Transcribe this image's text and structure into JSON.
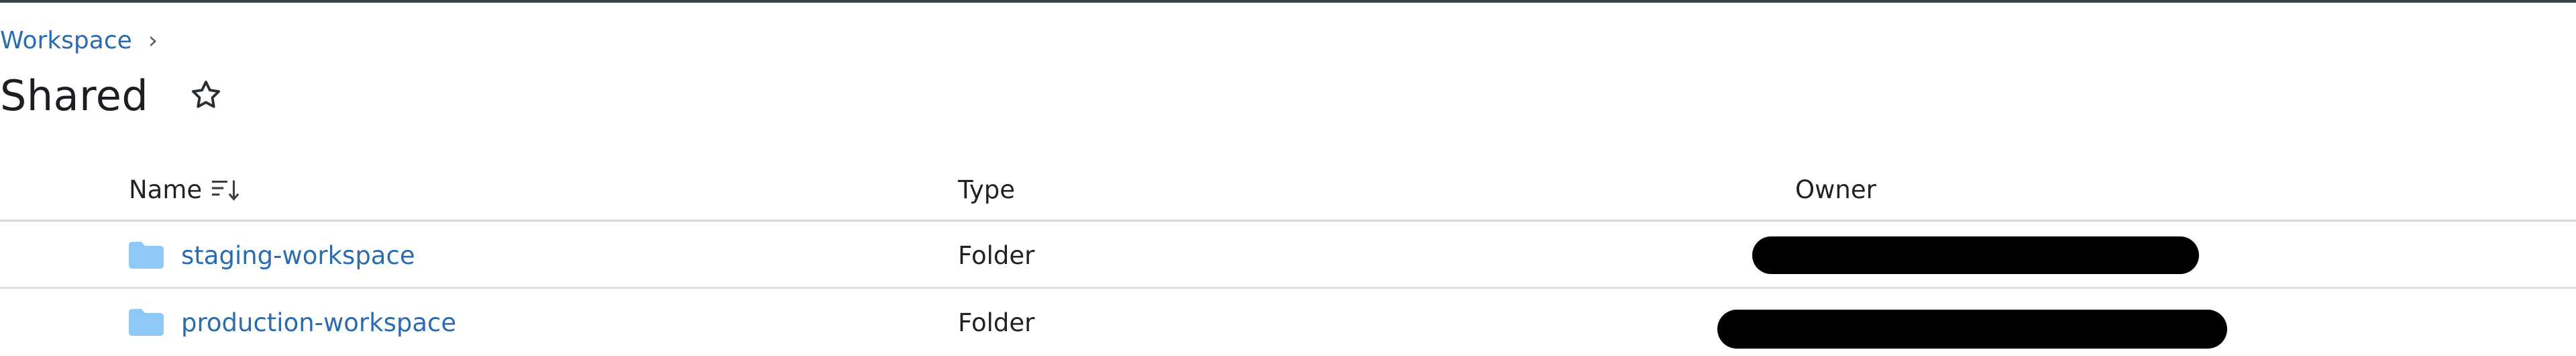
{
  "breadcrumb": {
    "items": [
      {
        "label": "Workspace"
      }
    ],
    "separator": "›"
  },
  "page": {
    "title": "Shared"
  },
  "table": {
    "columns": {
      "name": "Name",
      "type": "Type",
      "owner": "Owner"
    },
    "rows": [
      {
        "name": "staging-workspace",
        "type": "Folder",
        "owner_redacted": true
      },
      {
        "name": "production-workspace",
        "type": "Folder",
        "owner_redacted": true
      }
    ]
  },
  "colors": {
    "link": "#2b6cb0",
    "folder_icon": "#8ec9f5",
    "divider": "#d4d7db",
    "redaction": "#000000"
  },
  "icons": {
    "star": "star-outline-icon",
    "sort": "sort-descending-icon",
    "folder": "folder-icon"
  }
}
